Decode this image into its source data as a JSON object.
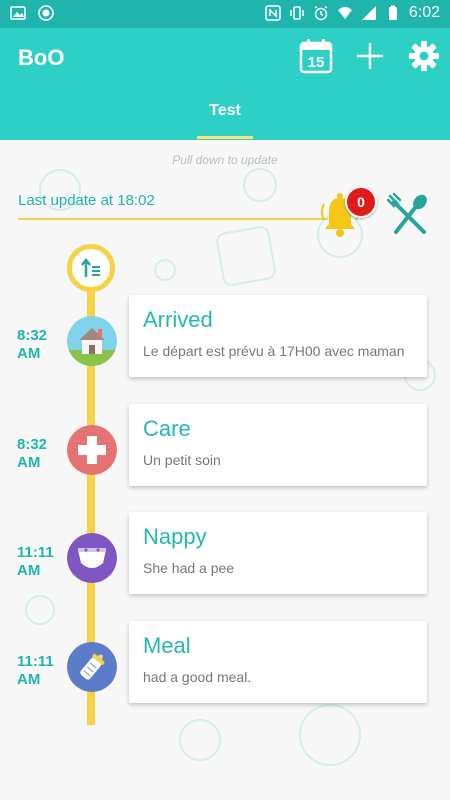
{
  "status_bar": {
    "time": "6:02"
  },
  "app": {
    "title": "BoO",
    "calendar_day": "15"
  },
  "tabs": [
    {
      "label": "Test"
    }
  ],
  "pull_hint": "Pull down to update",
  "last_update": "Last update at 18:02",
  "notifications_count": "0",
  "colors": {
    "primary": "#2ecfc4",
    "status_bar": "#1fb5ad",
    "accent_yellow": "#f5d248",
    "badge": "#e01b1b"
  },
  "entries": [
    {
      "time": "8:32",
      "ampm": "AM",
      "title": "Arrived",
      "desc": "Le départ est prévu à 17H00 avec maman",
      "icon": "house-icon"
    },
    {
      "time": "8:32",
      "ampm": "AM",
      "title": "Care",
      "desc": "Un petit soin",
      "icon": "medical-cross-icon"
    },
    {
      "time": "11:11",
      "ampm": "AM",
      "title": "Nappy",
      "desc": "She had a pee",
      "icon": "nappy-icon"
    },
    {
      "time": "11:11",
      "ampm": "AM",
      "title": "Meal",
      "desc": "had a good meal.",
      "icon": "baby-bottle-icon"
    }
  ]
}
